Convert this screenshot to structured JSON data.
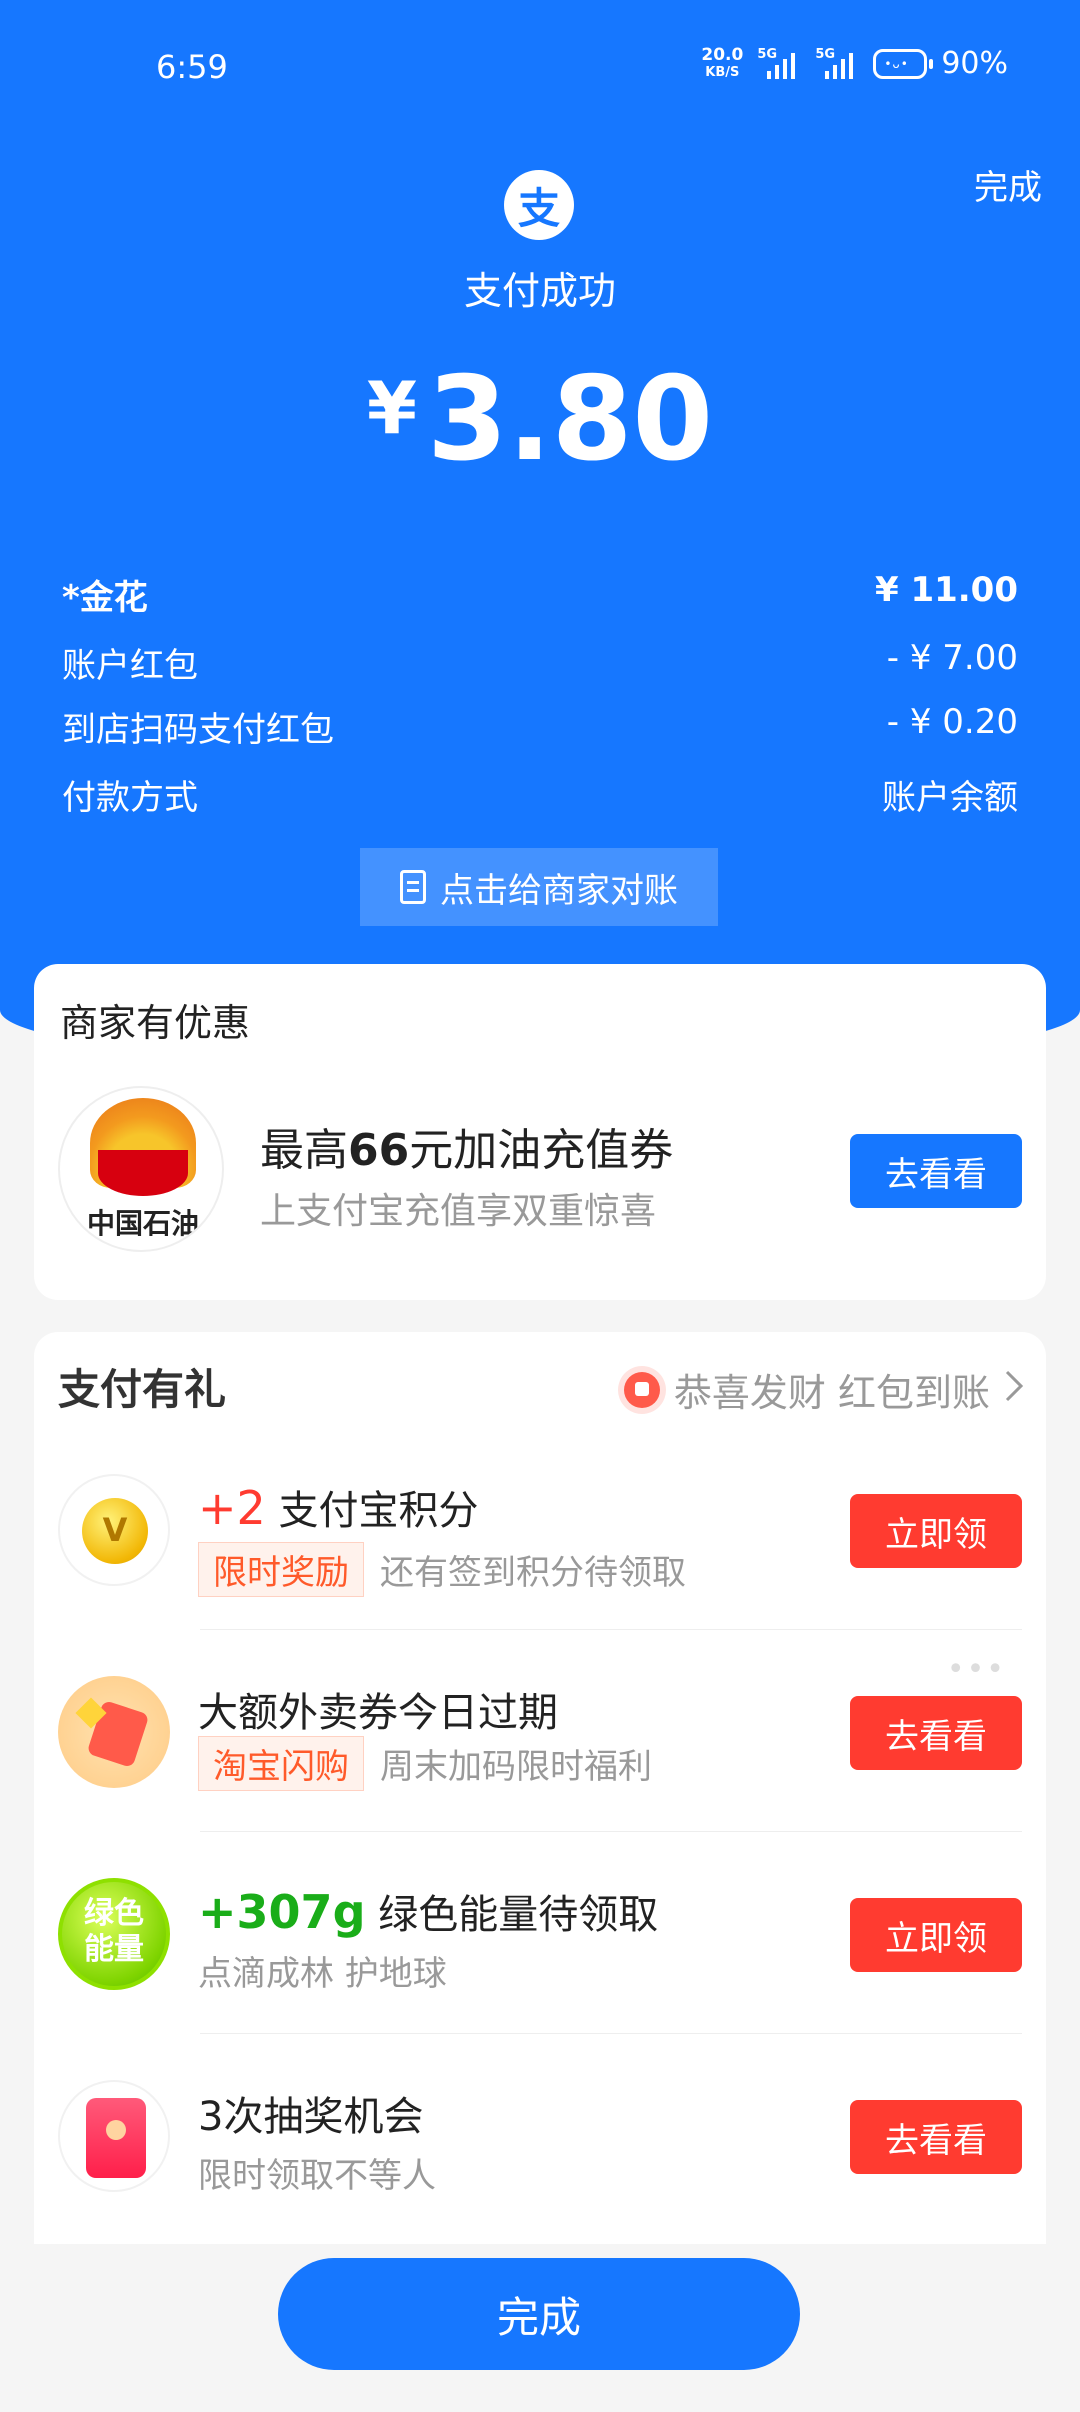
{
  "status_bar": {
    "time": "6:59",
    "net_speed_value": "20.0",
    "net_speed_unit": "KB/S",
    "signal1_label": "5G",
    "signal2_label": "5G",
    "battery_face": "•ᴗ•",
    "battery_percent": "90%"
  },
  "header": {
    "done_label": "完成",
    "logo_char": "支",
    "title": "支付成功",
    "currency": "¥",
    "amount": "3.80"
  },
  "details": [
    {
      "label": "*金花",
      "value": "¥ 11.00"
    },
    {
      "label": "账户红包",
      "value": "- ¥ 7.00"
    },
    {
      "label": "到店扫码支付红包",
      "value": "- ¥ 0.20"
    },
    {
      "label": "付款方式",
      "value": "账户余额"
    }
  ],
  "reconcile_label": "点击给商家对账",
  "merchant_offer": {
    "section_title": "商家有优惠",
    "logo_text": "中国石油",
    "title_prefix": "最高",
    "title_bold": "66",
    "title_suffix": "元加油充值券",
    "subtitle": "上支付宝充值享双重惊喜",
    "button": "去看看"
  },
  "rewards": {
    "section_title": "支付有礼",
    "congrats": "恭喜发财 红包到账",
    "more": "•••",
    "items": [
      {
        "num": "+2",
        "title": "支付宝积分",
        "tag": "限时奖励",
        "sub": "还有签到积分待领取",
        "button": "立即领"
      },
      {
        "title": "大额外卖券今日过期",
        "tag": "淘宝闪购",
        "sub": "周末加码限时福利",
        "button": "去看看"
      },
      {
        "num": "+307g",
        "title": "绿色能量待领取",
        "icon_text": "绿色\n能量",
        "sub": "点滴成林 护地球",
        "button": "立即领"
      },
      {
        "title": "3次抽奖机会",
        "sub": "限时领取不等人",
        "button": "去看看"
      }
    ]
  },
  "bottom_button": "完成",
  "colors": {
    "primary": "#1677ff",
    "danger": "#ff3b30",
    "green": "#1aad19"
  }
}
